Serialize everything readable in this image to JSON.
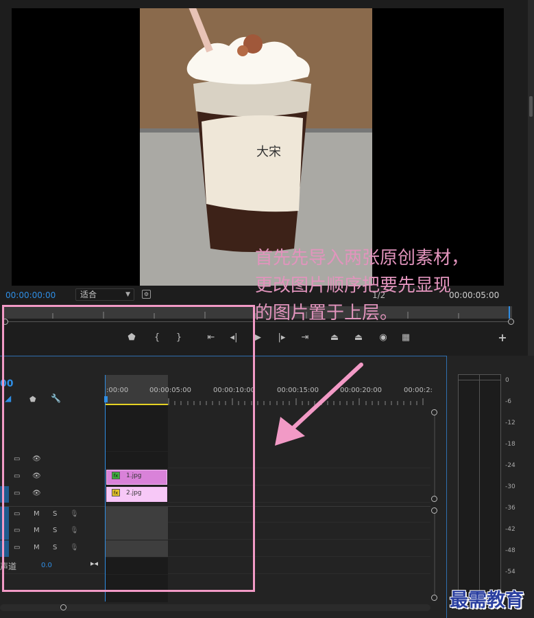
{
  "program_monitor": {
    "timecode_current": "00:00:00:00",
    "fit_select": "适合",
    "resolution": "1/2",
    "timecode_duration": "00:00:05:00"
  },
  "transport_icons": [
    "marker-icon",
    "in-point-icon",
    "out-point-icon",
    "go-to-in-icon",
    "step-back-icon",
    "play-icon",
    "step-forward-icon",
    "go-to-out-icon",
    "lift-icon",
    "extract-icon",
    "export-frame-icon",
    "comparison-icon",
    "add-button-icon"
  ],
  "timeline": {
    "timecode": "00",
    "ruler_labels": [
      ":00:00",
      "00:00:05:00",
      "00:00:10:00",
      "00:00:15:00",
      "00:00:20:00",
      "00:00:2:"
    ],
    "clips": [
      {
        "name": "1.jpg",
        "fx": "fx",
        "color": "#d982d9"
      },
      {
        "name": "2.jpg",
        "fx": "fx",
        "color": "#f7c8f7"
      }
    ],
    "audio_track_buttons": {
      "mute": "M",
      "solo": "S"
    },
    "master_label": "声道",
    "master_value": "0.0"
  },
  "audio_meter": {
    "db_labels": [
      "0",
      "-6",
      "-12",
      "-18",
      "-24",
      "-30",
      "-36",
      "-42",
      "-48",
      "-54"
    ]
  },
  "annotation": {
    "line1": "首先先导入两张原创素材，",
    "line2": "更改图片顺序把要先显现",
    "line3": "的图片置于上层。"
  },
  "watermark": "最需教育",
  "colors": {
    "accent": "#2f8ee5",
    "annotation": "#e294bd",
    "box": "#f29ac6"
  }
}
